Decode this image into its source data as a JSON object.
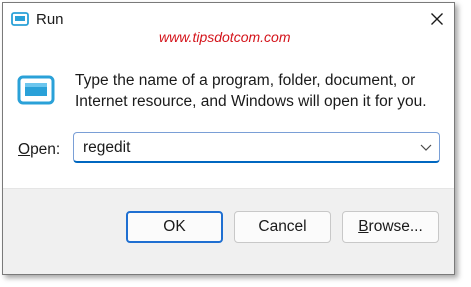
{
  "window": {
    "title": "Run",
    "watermark": "www.tipsdotcom.com"
  },
  "dialog": {
    "description_line1": "Type the name of a program, folder, document, or",
    "description_line2": "Internet resource, and Windows will open it for you.",
    "open_label_accel": "O",
    "open_label_rest": "pen:",
    "open_value": "regedit"
  },
  "buttons": {
    "ok": "OK",
    "cancel": "Cancel",
    "browse_accel": "B",
    "browse_rest": "rowse..."
  },
  "icons": {
    "app": "run-icon",
    "close": "close-icon",
    "dropdown": "chevron-down-icon"
  },
  "colors": {
    "accent": "#0067c0",
    "watermark": "#d4141b",
    "icon_blue": "#2aa1d8"
  }
}
